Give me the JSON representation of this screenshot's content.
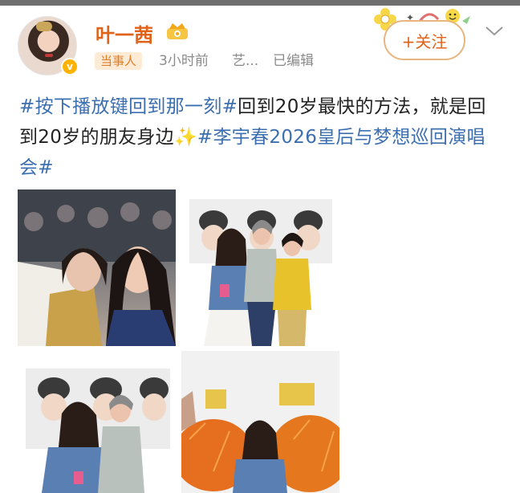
{
  "user": {
    "name": "叶一茜",
    "role_tag": "当事人",
    "time": "3小时前",
    "source": "艺...",
    "edited": "已编辑",
    "follow_label": "+关注",
    "avatar_badge": "v"
  },
  "post": {
    "segments": [
      {
        "text": "#按下播放键回到那一刻#",
        "type": "tag"
      },
      {
        "text": "回到20岁最快的方法，就是回到20岁的朋友身边",
        "type": "plain"
      },
      {
        "text": "✨",
        "type": "emoji"
      },
      {
        "text": "#李宇春2026皇后与梦想巡回演唱会#",
        "type": "tag"
      }
    ]
  },
  "photos": [
    {
      "alt": "selfie at concert"
    },
    {
      "alt": "three women before poster"
    },
    {
      "alt": "two women before poster"
    },
    {
      "alt": "woman with orange flower display"
    }
  ],
  "colors": {
    "username": "#e0631a",
    "hashtag": "#3c6fb0",
    "tag_bg": "#fdebd6",
    "follow_border": "#e8b57f"
  },
  "icons": {
    "vip": "crown-badge-icon",
    "chevron": "chevron-down-icon",
    "verified": "verified-badge-icon",
    "decor": "flower-sticker-icon"
  }
}
